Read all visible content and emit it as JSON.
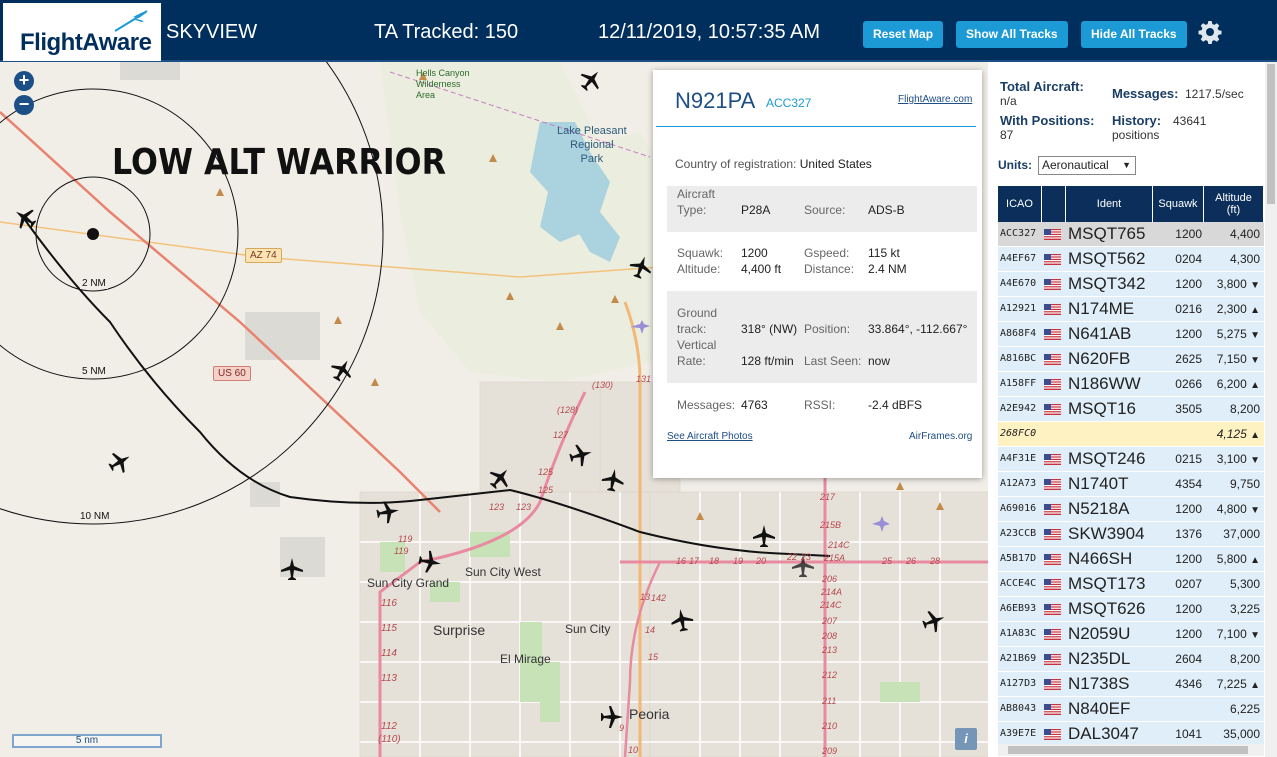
{
  "header": {
    "logo": "FlightAware",
    "site_name": "SKYVIEW",
    "tracked": "TA Tracked: 150",
    "datetime": "12/11/2019, 10:57:35 AM",
    "reset_map": "Reset Map",
    "show_all_tracks": "Show All Tracks",
    "hide_all_tracks": "Hide All Tracks",
    "settings_icon": "gear-icon"
  },
  "map": {
    "overlay_title": "LOW ALT WARRIOR",
    "zoom_in": "+",
    "zoom_out": "−",
    "scale": "5 nm",
    "info": "i",
    "rings": [
      "2 NM",
      "5 NM",
      "10 NM"
    ],
    "places": {
      "hells_canyon": "Hells Canyon\nWilderness\nArea",
      "lake_pleasant": "Lake Pleasant\nRegional\nPark",
      "sun_city_grand": "Sun City Grand",
      "sun_city_west": "Sun City West",
      "surprise": "Surprise",
      "sun_city": "Sun City",
      "el_mirage": "El Mirage",
      "peoria": "Peoria"
    },
    "shields": {
      "az74": "AZ 74",
      "us60": "US 60"
    },
    "route_numbers": [
      "(130)",
      "131",
      "(128)",
      "127",
      "125",
      "125",
      "123",
      "123",
      "119",
      "119",
      "116",
      "115",
      "114",
      "113",
      "112",
      "(110)",
      "217",
      "215B",
      "215A",
      "214C",
      "214A",
      "214C",
      "213",
      "212",
      "211",
      "210",
      "209",
      "208",
      "207",
      "206",
      "142",
      "13",
      "14",
      "15",
      "16",
      "17",
      "18",
      "19",
      "20",
      "22",
      "23",
      "25",
      "26",
      "28",
      "9",
      "10"
    ]
  },
  "popup": {
    "ident": "N921PA",
    "icao": "ACC327",
    "fa_link": "FlightAware.com",
    "country_label": "Country of registration:",
    "country": "United States",
    "aircraft_type_label": "Aircraft\nType:",
    "aircraft_type": "P28A",
    "source_label": "Source:",
    "source": "ADS-B",
    "squawk_label": "Squawk:",
    "squawk": "1200",
    "altitude_label": "Altitude:",
    "altitude": "4,400 ft",
    "gspeed_label": "Gspeed:",
    "gspeed": "115 kt",
    "distance_label": "Distance:",
    "distance": "2.4 NM",
    "ground_track_label": "Ground\ntrack:",
    "ground_track": "318° (NW)",
    "position_label": "Position:",
    "position": "33.864°, -112.667°",
    "vrate_label": "Vertical\nRate:",
    "vrate": "128 ft/min",
    "last_seen_label": "Last Seen:",
    "last_seen": "now",
    "messages_label": "Messages:",
    "messages": "4763",
    "rssi_label": "RSSI:",
    "rssi": "-2.4 dBFS",
    "photos_link": "See Aircraft Photos",
    "airframes_link": "AirFrames.org"
  },
  "stats": {
    "total_label": "Total Aircraft:",
    "total_value": "n/a",
    "positions_label": "With Positions:",
    "positions_value": "87",
    "messages_label": "Messages:",
    "messages_value": "1217.5/sec",
    "history_label": "History:",
    "history_value": "43641",
    "history_unit": "positions",
    "units_label": "Units:",
    "units_value": "Aeronautical"
  },
  "table": {
    "columns": [
      "ICAO",
      "Ident",
      "Squawk",
      "Altitude\n(ft)"
    ],
    "rows": [
      {
        "icao": "ACC327",
        "flag": true,
        "ident": "MSQT765",
        "squawk": "1200",
        "alt": "4,400",
        "trend": "",
        "state": "selected"
      },
      {
        "icao": "A4EF67",
        "flag": true,
        "ident": "MSQT562",
        "squawk": "0204",
        "alt": "4,300",
        "trend": "",
        "state": ""
      },
      {
        "icao": "A4E670",
        "flag": true,
        "ident": "MSQT342",
        "squawk": "1200",
        "alt": "3,800",
        "trend": "▼",
        "state": ""
      },
      {
        "icao": "A12921",
        "flag": true,
        "ident": "N174ME",
        "squawk": "0216",
        "alt": "2,300",
        "trend": "▲",
        "state": ""
      },
      {
        "icao": "A868F4",
        "flag": true,
        "ident": "N641AB",
        "squawk": "1200",
        "alt": "5,275",
        "trend": "▼",
        "state": ""
      },
      {
        "icao": "A816BC",
        "flag": true,
        "ident": "N620FB",
        "squawk": "2625",
        "alt": "7,150",
        "trend": "▼",
        "state": ""
      },
      {
        "icao": "A158FF",
        "flag": true,
        "ident": "N186WW",
        "squawk": "0266",
        "alt": "6,200",
        "trend": "▲",
        "state": ""
      },
      {
        "icao": "A2E942",
        "flag": true,
        "ident": "MSQT16",
        "squawk": "3505",
        "alt": "8,200",
        "trend": "",
        "state": ""
      },
      {
        "icao": "268FC0",
        "flag": false,
        "ident": "",
        "squawk": "",
        "alt": "4,125",
        "trend": "▲",
        "state": "highlight"
      },
      {
        "icao": "A4F31E",
        "flag": true,
        "ident": "MSQT246",
        "squawk": "0215",
        "alt": "3,100",
        "trend": "▼",
        "state": ""
      },
      {
        "icao": "A12A73",
        "flag": true,
        "ident": "N1740T",
        "squawk": "4354",
        "alt": "9,750",
        "trend": "",
        "state": ""
      },
      {
        "icao": "A69016",
        "flag": true,
        "ident": "N5218A",
        "squawk": "1200",
        "alt": "4,800",
        "trend": "▼",
        "state": ""
      },
      {
        "icao": "A23CCB",
        "flag": true,
        "ident": "SKW3904",
        "squawk": "1376",
        "alt": "37,000",
        "trend": "",
        "state": ""
      },
      {
        "icao": "A5B17D",
        "flag": true,
        "ident": "N466SH",
        "squawk": "1200",
        "alt": "5,800",
        "trend": "▲",
        "state": ""
      },
      {
        "icao": "ACCE4C",
        "flag": true,
        "ident": "MSQT173",
        "squawk": "0207",
        "alt": "5,300",
        "trend": "",
        "state": ""
      },
      {
        "icao": "A6EB93",
        "flag": true,
        "ident": "MSQT626",
        "squawk": "1200",
        "alt": "3,225",
        "trend": "",
        "state": ""
      },
      {
        "icao": "A1A83C",
        "flag": true,
        "ident": "N2059U",
        "squawk": "1200",
        "alt": "7,100",
        "trend": "▼",
        "state": ""
      },
      {
        "icao": "A21B69",
        "flag": true,
        "ident": "N235DL",
        "squawk": "2604",
        "alt": "8,200",
        "trend": "",
        "state": ""
      },
      {
        "icao": "A127D3",
        "flag": true,
        "ident": "N1738S",
        "squawk": "4346",
        "alt": "7,225",
        "trend": "▲",
        "state": ""
      },
      {
        "icao": "AB8043",
        "flag": true,
        "ident": "N840EF",
        "squawk": "",
        "alt": "6,225",
        "trend": "",
        "state": ""
      },
      {
        "icao": "A39E7E",
        "flag": true,
        "ident": "DAL3047",
        "squawk": "1041",
        "alt": "35,000",
        "trend": "",
        "state": ""
      }
    ]
  }
}
